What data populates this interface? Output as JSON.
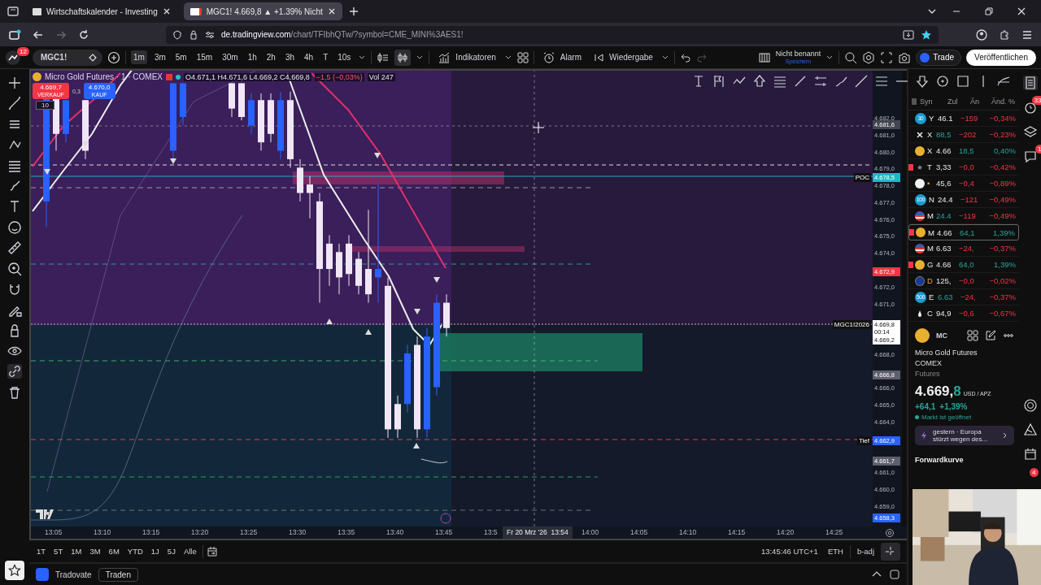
{
  "browser": {
    "tabs": [
      {
        "title": "Wirtschaftskalender - Investing",
        "selected": false
      },
      {
        "title": "MGC1! 4.669,8 ▲ +1.39% Nicht",
        "selected": true
      }
    ],
    "address": {
      "domain": "de.tradingview.com",
      "path": "/chart/TFIbhQTw/?symbol=CME_MINI%3AES1!"
    }
  },
  "toolbar": {
    "alerts_badge": "12",
    "symbol": "MGC1!",
    "intervals": [
      {
        "label": "1m",
        "selected": true
      },
      {
        "label": "3m",
        "selected": false
      },
      {
        "label": "5m",
        "selected": false
      },
      {
        "label": "15m",
        "selected": false
      },
      {
        "label": "30m",
        "selected": false
      },
      {
        "label": "1h",
        "selected": false
      },
      {
        "label": "2h",
        "selected": false
      },
      {
        "label": "3h",
        "selected": false
      },
      {
        "label": "4h",
        "selected": false
      },
      {
        "label": "T",
        "selected": false
      },
      {
        "label": "10s",
        "selected": false
      }
    ],
    "indicators": "Indikatoren",
    "alarm": "Alarm",
    "replay": "Wiedergabe",
    "layout_name": "Nicht benannt",
    "layout_save": "Speichern",
    "trade": "Trade",
    "publish": "Veröffentlichen"
  },
  "chart": {
    "title": "Micro Gold Futures · 1 · COMEX",
    "ohlc": "O4.671,1 H4.671,6 L4.669,2 C4.669,8",
    "change": "−1,5 (−0,03%)",
    "volume": "Vol 247",
    "sell": {
      "price": "4.669,7",
      "label": "VERKAUF"
    },
    "spread": "0,3",
    "buy": {
      "price": "4.670,0",
      "label": "KAUF"
    },
    "quantity": "10",
    "price_ticks": [
      "4.682,0",
      "4.681,0",
      "4.680,0",
      "4.679,0",
      "4.678,0",
      "4.677,0",
      "4.676,0",
      "4.675,0",
      "4.674,0",
      "4.672,0",
      "4.671,0",
      "4.668,0",
      "4.666,0",
      "4.665,0",
      "4.664,0",
      "4.661,0",
      "4.660,0",
      "4.659,0"
    ],
    "price_tags": [
      {
        "price": "4.681,6",
        "color": "#434651"
      },
      {
        "price": "4.678,5",
        "color": "#22b5c6",
        "line_label": "POC"
      },
      {
        "price": "4.672,9",
        "color": "#f23645"
      },
      {
        "price": "4.669,8",
        "color": "#ffffff",
        "countdown": "00:14",
        "line_label": "MGC1!2026"
      },
      {
        "price": "4.669,2",
        "color": "#ffffff"
      },
      {
        "price": "4.666,8",
        "color": "#5d606b"
      },
      {
        "price": "4.662,9",
        "color": "#2962ff",
        "line_label": "Tief"
      },
      {
        "price": "4.661,7",
        "color": "#5d606b"
      },
      {
        "price": "4.658,3",
        "color": "#2962ff"
      }
    ],
    "time_ticks": [
      "13:05",
      "13:10",
      "13:15",
      "13:20",
      "13:25",
      "13:30",
      "13:35",
      "13:40",
      "13:45",
      "13:5",
      "14:00",
      "14:05",
      "14:10",
      "14:15",
      "14:20",
      "14:25"
    ],
    "crosshair": {
      "date": "Fr 20 Mrz '26",
      "time": "13:54"
    }
  },
  "range_buttons": [
    "1T",
    "5T",
    "1M",
    "3M",
    "6M",
    "YTD",
    "1J",
    "5J",
    "Alle"
  ],
  "status": {
    "time": "13:45:46 UTC+1",
    "session": "ETH",
    "adjust": "b-adj"
  },
  "broker": {
    "name": "Tradovate",
    "action": "Traden"
  },
  "watchlist": {
    "columns": [
      "Syn",
      "Zul",
      "Än",
      "Änd. %"
    ],
    "rows": [
      {
        "kind": "number",
        "badge": "30",
        "symbol": "Y",
        "last": "46.1",
        "change": "−159",
        "pct": "−0,34%",
        "positive": false,
        "last_up": false,
        "flagged": false,
        "selected": false
      },
      {
        "kind": "cross",
        "symbol": "X",
        "last": "88,5",
        "change": "−202",
        "pct": "−0,23%",
        "positive": false,
        "last_up": true,
        "flagged": false,
        "selected": false
      },
      {
        "kind": "coin",
        "symbol": "X",
        "last": "4.66",
        "change": "18,5",
        "pct": "0,40%",
        "positive": true,
        "last_up": false,
        "flagged": false,
        "selected": false
      },
      {
        "kind": "star",
        "symbol": "T",
        "last": "3,33",
        "change": "−0,0",
        "pct": "−0,42%",
        "positive": false,
        "last_up": false,
        "flagged": true,
        "selected": false
      },
      {
        "kind": "gauge",
        "symbol": "•",
        "last": "45,6",
        "change": "−0,4",
        "pct": "−0,89%",
        "positive": false,
        "last_up": false,
        "flagged": false,
        "selected": false
      },
      {
        "kind": "number",
        "badge": "100",
        "symbol": "N",
        "last": "24.4",
        "change": "−121",
        "pct": "−0,49%",
        "positive": false,
        "last_up": false,
        "flagged": false,
        "selected": false
      },
      {
        "kind": "flag-us",
        "symbol": "M",
        "last": "24.4",
        "change": "−119",
        "pct": "−0,49%",
        "positive": false,
        "last_up": true,
        "flagged": false,
        "selected": false
      },
      {
        "kind": "coin",
        "symbol": "M",
        "last": "4.66",
        "change": "64,1",
        "pct": "1,39%",
        "positive": true,
        "last_up": false,
        "flagged": true,
        "selected": true
      },
      {
        "kind": "flag-us",
        "symbol": "M",
        "last": "6.63",
        "change": "−24,",
        "pct": "−0,37%",
        "positive": false,
        "last_up": false,
        "flagged": false,
        "selected": false
      },
      {
        "kind": "coin",
        "symbol": "G",
        "last": "4.66",
        "change": "64,0",
        "pct": "1,39%",
        "positive": true,
        "last_up": false,
        "flagged": true,
        "selected": false
      },
      {
        "kind": "flag-eu",
        "symbol": "D",
        "last": "125,",
        "change": "−0,0",
        "pct": "−0,02%",
        "positive": false,
        "last_up": false,
        "flagged": false,
        "selected": false
      },
      {
        "kind": "number",
        "badge": "500",
        "symbol": "E",
        "last": "6.63",
        "change": "−24,",
        "pct": "−0,37%",
        "positive": false,
        "last_up": true,
        "flagged": false,
        "selected": false
      },
      {
        "kind": "drop",
        "symbol": "C",
        "last": "94,9",
        "change": "−0,6",
        "pct": "−0,67%",
        "positive": false,
        "last_up": false,
        "flagged": false,
        "selected": false
      }
    ]
  },
  "details": {
    "symbol": "MC",
    "name": "Micro Gold Futures",
    "exchange": "COMEX",
    "type": "Futures",
    "price": "4.669,",
    "price_tail": "8",
    "currency": "USD / APZ",
    "change": "+64,1",
    "change_pct": "+1,39%",
    "market_status": "Markt ist geöffnet",
    "market_open": true,
    "news": "gestern · Europa stürzt wegen des...",
    "section": "Forwardkurve"
  },
  "side_badges": [
    "33",
    "1",
    "4"
  ],
  "webcam": {
    "kind": "picture"
  }
}
